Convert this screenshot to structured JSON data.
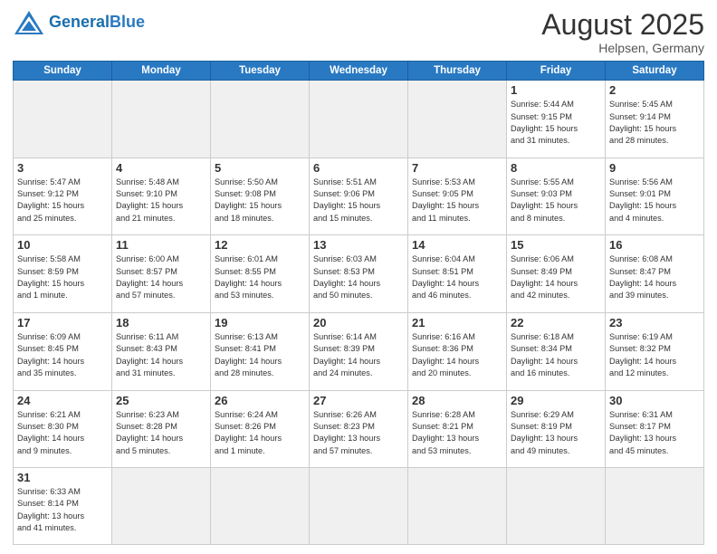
{
  "header": {
    "logo_general": "General",
    "logo_blue": "Blue",
    "title": "August 2025",
    "location": "Helpsen, Germany"
  },
  "weekdays": [
    "Sunday",
    "Monday",
    "Tuesday",
    "Wednesday",
    "Thursday",
    "Friday",
    "Saturday"
  ],
  "weeks": [
    [
      {
        "day": "",
        "empty": true
      },
      {
        "day": "",
        "empty": true
      },
      {
        "day": "",
        "empty": true
      },
      {
        "day": "",
        "empty": true
      },
      {
        "day": "",
        "empty": true
      },
      {
        "day": "1",
        "info": "Sunrise: 5:44 AM\nSunset: 9:15 PM\nDaylight: 15 hours\nand 31 minutes."
      },
      {
        "day": "2",
        "info": "Sunrise: 5:45 AM\nSunset: 9:14 PM\nDaylight: 15 hours\nand 28 minutes."
      }
    ],
    [
      {
        "day": "3",
        "info": "Sunrise: 5:47 AM\nSunset: 9:12 PM\nDaylight: 15 hours\nand 25 minutes."
      },
      {
        "day": "4",
        "info": "Sunrise: 5:48 AM\nSunset: 9:10 PM\nDaylight: 15 hours\nand 21 minutes."
      },
      {
        "day": "5",
        "info": "Sunrise: 5:50 AM\nSunset: 9:08 PM\nDaylight: 15 hours\nand 18 minutes."
      },
      {
        "day": "6",
        "info": "Sunrise: 5:51 AM\nSunset: 9:06 PM\nDaylight: 15 hours\nand 15 minutes."
      },
      {
        "day": "7",
        "info": "Sunrise: 5:53 AM\nSunset: 9:05 PM\nDaylight: 15 hours\nand 11 minutes."
      },
      {
        "day": "8",
        "info": "Sunrise: 5:55 AM\nSunset: 9:03 PM\nDaylight: 15 hours\nand 8 minutes."
      },
      {
        "day": "9",
        "info": "Sunrise: 5:56 AM\nSunset: 9:01 PM\nDaylight: 15 hours\nand 4 minutes."
      }
    ],
    [
      {
        "day": "10",
        "info": "Sunrise: 5:58 AM\nSunset: 8:59 PM\nDaylight: 15 hours\nand 1 minute."
      },
      {
        "day": "11",
        "info": "Sunrise: 6:00 AM\nSunset: 8:57 PM\nDaylight: 14 hours\nand 57 minutes."
      },
      {
        "day": "12",
        "info": "Sunrise: 6:01 AM\nSunset: 8:55 PM\nDaylight: 14 hours\nand 53 minutes."
      },
      {
        "day": "13",
        "info": "Sunrise: 6:03 AM\nSunset: 8:53 PM\nDaylight: 14 hours\nand 50 minutes."
      },
      {
        "day": "14",
        "info": "Sunrise: 6:04 AM\nSunset: 8:51 PM\nDaylight: 14 hours\nand 46 minutes."
      },
      {
        "day": "15",
        "info": "Sunrise: 6:06 AM\nSunset: 8:49 PM\nDaylight: 14 hours\nand 42 minutes."
      },
      {
        "day": "16",
        "info": "Sunrise: 6:08 AM\nSunset: 8:47 PM\nDaylight: 14 hours\nand 39 minutes."
      }
    ],
    [
      {
        "day": "17",
        "info": "Sunrise: 6:09 AM\nSunset: 8:45 PM\nDaylight: 14 hours\nand 35 minutes."
      },
      {
        "day": "18",
        "info": "Sunrise: 6:11 AM\nSunset: 8:43 PM\nDaylight: 14 hours\nand 31 minutes."
      },
      {
        "day": "19",
        "info": "Sunrise: 6:13 AM\nSunset: 8:41 PM\nDaylight: 14 hours\nand 28 minutes."
      },
      {
        "day": "20",
        "info": "Sunrise: 6:14 AM\nSunset: 8:39 PM\nDaylight: 14 hours\nand 24 minutes."
      },
      {
        "day": "21",
        "info": "Sunrise: 6:16 AM\nSunset: 8:36 PM\nDaylight: 14 hours\nand 20 minutes."
      },
      {
        "day": "22",
        "info": "Sunrise: 6:18 AM\nSunset: 8:34 PM\nDaylight: 14 hours\nand 16 minutes."
      },
      {
        "day": "23",
        "info": "Sunrise: 6:19 AM\nSunset: 8:32 PM\nDaylight: 14 hours\nand 12 minutes."
      }
    ],
    [
      {
        "day": "24",
        "info": "Sunrise: 6:21 AM\nSunset: 8:30 PM\nDaylight: 14 hours\nand 9 minutes."
      },
      {
        "day": "25",
        "info": "Sunrise: 6:23 AM\nSunset: 8:28 PM\nDaylight: 14 hours\nand 5 minutes."
      },
      {
        "day": "26",
        "info": "Sunrise: 6:24 AM\nSunset: 8:26 PM\nDaylight: 14 hours\nand 1 minute."
      },
      {
        "day": "27",
        "info": "Sunrise: 6:26 AM\nSunset: 8:23 PM\nDaylight: 13 hours\nand 57 minutes."
      },
      {
        "day": "28",
        "info": "Sunrise: 6:28 AM\nSunset: 8:21 PM\nDaylight: 13 hours\nand 53 minutes."
      },
      {
        "day": "29",
        "info": "Sunrise: 6:29 AM\nSunset: 8:19 PM\nDaylight: 13 hours\nand 49 minutes."
      },
      {
        "day": "30",
        "info": "Sunrise: 6:31 AM\nSunset: 8:17 PM\nDaylight: 13 hours\nand 45 minutes."
      }
    ],
    [
      {
        "day": "31",
        "info": "Sunrise: 6:33 AM\nSunset: 8:14 PM\nDaylight: 13 hours\nand 41 minutes.",
        "last": true
      },
      {
        "day": "",
        "empty": true,
        "last": true
      },
      {
        "day": "",
        "empty": true,
        "last": true
      },
      {
        "day": "",
        "empty": true,
        "last": true
      },
      {
        "day": "",
        "empty": true,
        "last": true
      },
      {
        "day": "",
        "empty": true,
        "last": true
      },
      {
        "day": "",
        "empty": true,
        "last": true
      }
    ]
  ]
}
